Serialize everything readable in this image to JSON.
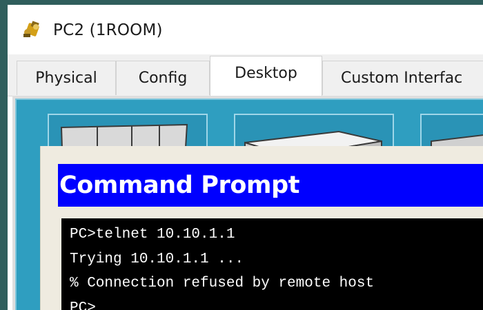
{
  "window": {
    "title": "PC2 (1ROOM)"
  },
  "tabs": [
    {
      "label": "Physical"
    },
    {
      "label": "Config"
    },
    {
      "label": "Desktop",
      "active": true
    },
    {
      "label": "Custom Interfac"
    }
  ],
  "command_prompt": {
    "title": "Command Prompt",
    "lines": [
      "PC>telnet 10.10.1.1",
      "Trying 10.10.1.1 ...",
      "% Connection refused by remote host",
      "PC>"
    ]
  },
  "colors": {
    "header_bar": "#0000ff",
    "terminal_bg": "#000000",
    "desktop_bg": "#2f9ec0",
    "outer_bg": "#2f5e5c"
  },
  "icons": {
    "app": "packet-tracer-pc-icon"
  }
}
